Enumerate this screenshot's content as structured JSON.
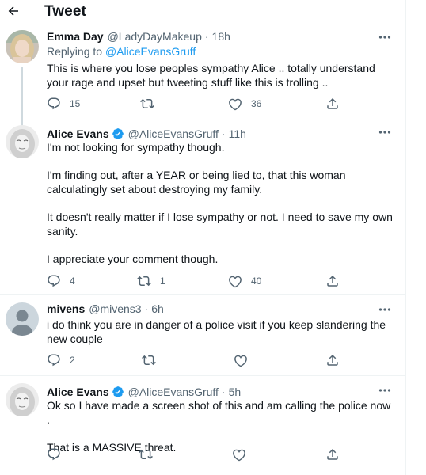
{
  "header": {
    "title": "Tweet",
    "back_icon": "arrow-left-icon"
  },
  "colors": {
    "text": "#0f1419",
    "secondary": "#536471",
    "accent": "#1d9bf0",
    "divider": "#eff3f4"
  },
  "tweets": [
    {
      "name": "Emma Day",
      "handle": "@LadyDayMakeup",
      "time": "18h",
      "verified": false,
      "replying_prefix": "Replying to ",
      "replying_handle": "@AliceEvansGruff",
      "paragraphs": [
        "This is where you lose peoples sympathy Alice .. totally understand your rage and upset but tweeting stuff like this is trolling .."
      ],
      "replies": "15",
      "retweets": "",
      "likes": "36"
    },
    {
      "name": "Alice Evans",
      "handle": "@AliceEvansGruff",
      "time": "11h",
      "verified": true,
      "paragraphs": [
        "I'm not looking for sympathy though.",
        "I'm finding out, after a YEAR or being lied to, that this woman calculatingly set about destroying my family.",
        "It doesn't really matter if I lose sympathy or not. I need to save my own sanity.",
        "I appreciate your comment though."
      ],
      "replies": "4",
      "retweets": "1",
      "likes": "40"
    },
    {
      "name": "mivens",
      "handle": "@mivens3",
      "time": "6h",
      "verified": false,
      "paragraphs": [
        "i do think you are in danger of a police visit if you keep slandering the new couple"
      ],
      "replies": "2",
      "retweets": "",
      "likes": ""
    },
    {
      "name": "Alice Evans",
      "handle": "@AliceEvansGruff",
      "time": "5h",
      "verified": true,
      "paragraphs": [
        "Ok so I have made a screen shot of this and am calling the police now .",
        "That is a MASSIVE threat."
      ],
      "replies": "",
      "retweets": "",
      "likes": ""
    }
  ]
}
